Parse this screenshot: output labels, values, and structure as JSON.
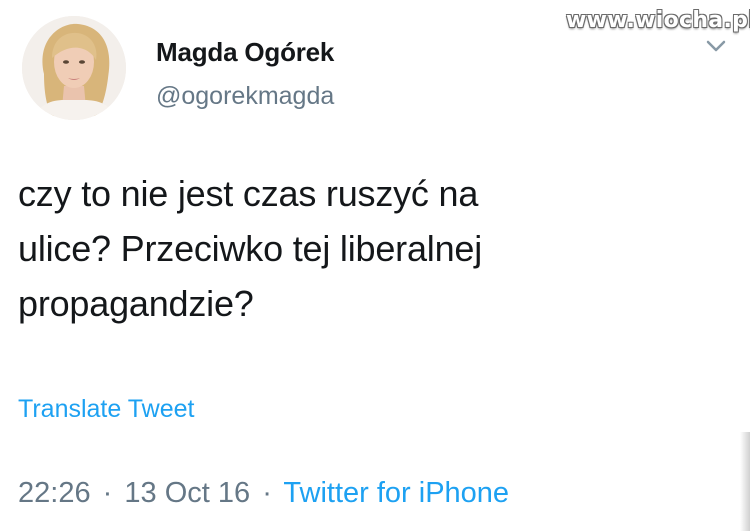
{
  "watermark": "www.wiocha.pl",
  "tweet": {
    "author": {
      "display_name": "Magda Ogórek",
      "handle": "@ogorekmagda",
      "avatar_icon": "profile-photo"
    },
    "text_lines": [
      "czy to nie jest czas ruszyć na",
      "ulice? Przeciwko tej liberalnej",
      "propagandzie?"
    ],
    "translate_label": "Translate Tweet",
    "time": "22:26",
    "date": "13 Oct 16",
    "separator": "·",
    "source": "Twitter for iPhone"
  },
  "colors": {
    "text": "#14171a",
    "secondary": "#657786",
    "link": "#1da1f2"
  }
}
